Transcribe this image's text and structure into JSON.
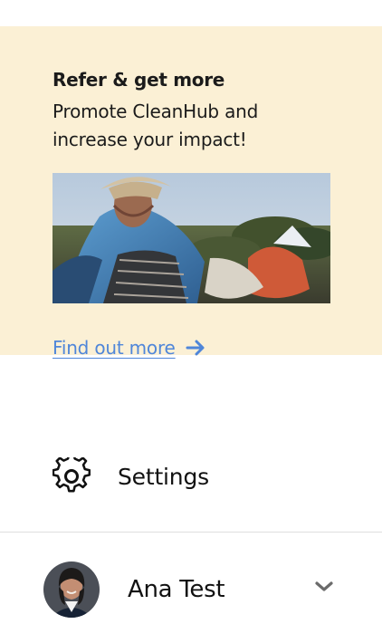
{
  "promo": {
    "title": "Refer & get more",
    "body": "Promote CleanHub and increase your impact!",
    "link_label": "Find out more",
    "link_color": "#4f86d9",
    "background": "#fbf0d5",
    "arrow_icon": "arrow-right-icon"
  },
  "settings": {
    "label": "Settings",
    "icon": "gear-icon"
  },
  "profile": {
    "name": "Ana Test",
    "expand_icon": "chevron-down-icon"
  }
}
